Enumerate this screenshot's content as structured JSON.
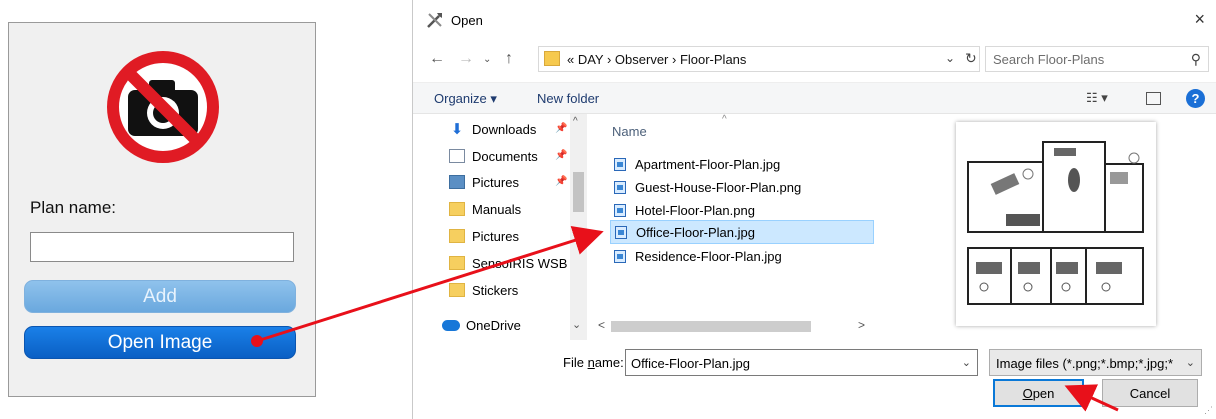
{
  "left_panel": {
    "plan_label": "Plan name:",
    "plan_value": "",
    "add_label": "Add",
    "open_image_label": "Open Image"
  },
  "dialog": {
    "title": "Open",
    "close_glyph": "×",
    "address": "«  DAY  ›  Observer  ›  Floor-Plans",
    "search_placeholder": "Search Floor-Plans",
    "organize": "Organize ▾",
    "new_folder": "New folder",
    "nav_items": [
      "Downloads",
      "Documents",
      "Pictures",
      "Manuals",
      "Pictures",
      "SensoIRIS WSB IR",
      "Stickers",
      "OneDrive"
    ],
    "column_name": "Name",
    "files": [
      "Apartment-Floor-Plan.jpg",
      "Guest-House-Floor-Plan.png",
      "Hotel-Floor-Plan.png",
      "Office-Floor-Plan.jpg",
      "Residence-Floor-Plan.jpg"
    ],
    "selected_file": "Office-Floor-Plan.jpg",
    "file_name_label_pre": "File ",
    "file_name_label_u": "n",
    "file_name_label_post": "ame:",
    "file_name_value": "Office-Floor-Plan.jpg",
    "filter": "Image files (*.png;*.bmp;*.jpg;*",
    "open_button_u": "O",
    "open_button_rest": "pen",
    "cancel_button": "Cancel"
  },
  "colors": {
    "accent": "#0a78d7",
    "annotation_red": "#e8101a",
    "selection": "#cce8ff"
  }
}
